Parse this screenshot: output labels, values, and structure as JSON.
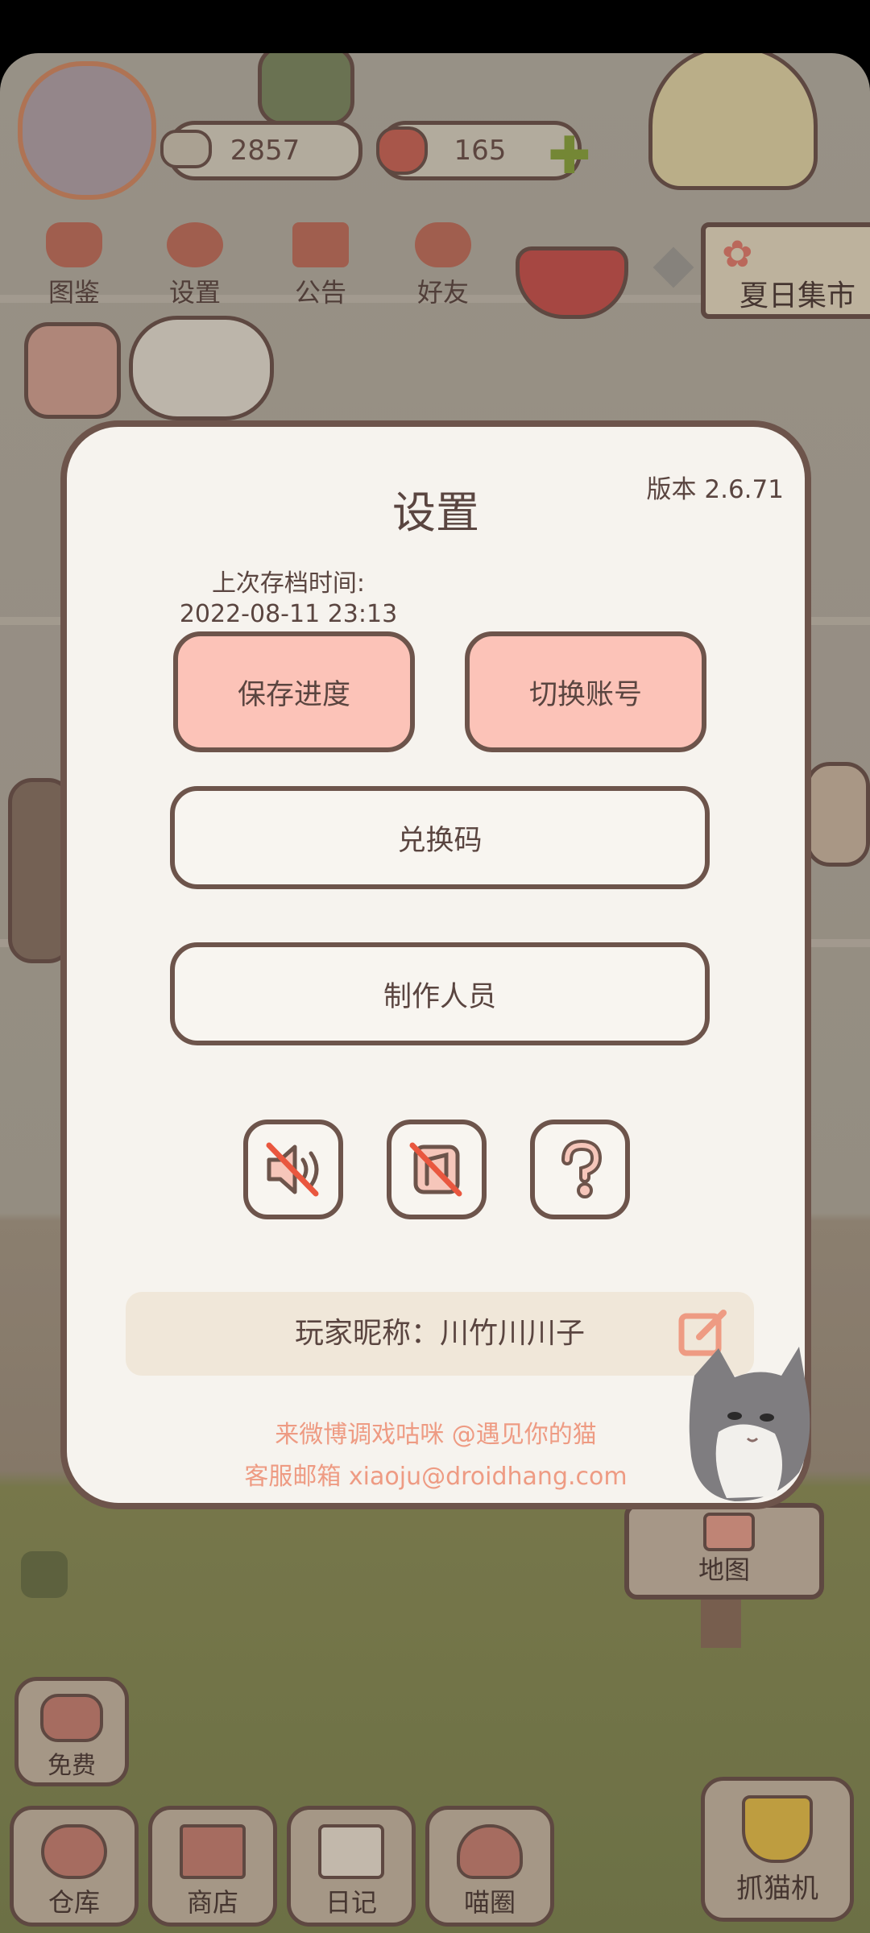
{
  "hud": {
    "fish_count": "2857",
    "heart_count": "165",
    "menu": [
      "图鉴",
      "设置",
      "公告",
      "好友"
    ],
    "event_sign": "夏日集市"
  },
  "map_label": "地图",
  "bottom_bar": {
    "free": "免费",
    "items": [
      "仓库",
      "商店",
      "日记",
      "喵圈"
    ],
    "claw": "抓猫机"
  },
  "settings": {
    "title": "设置",
    "version": "版本 2.6.71",
    "last_save_label": "上次存档时间:",
    "last_save_time": "2022-08-11 23:13",
    "save_button": "保存进度",
    "switch_account_button": "切换账号",
    "redeem_button": "兑换码",
    "credits_button": "制作人员",
    "nickname": "玩家昵称：川竹川川子",
    "weibo": "来微博调戏咕咪 @遇见你的猫",
    "email": "客服邮箱 xiaoju@droidhang.com"
  },
  "colors": {
    "accent_pink": "#fcc3b8",
    "outline_brown": "#6d544b",
    "link_orange": "#ee9b83",
    "panel_bg": "#f6f3ee"
  }
}
